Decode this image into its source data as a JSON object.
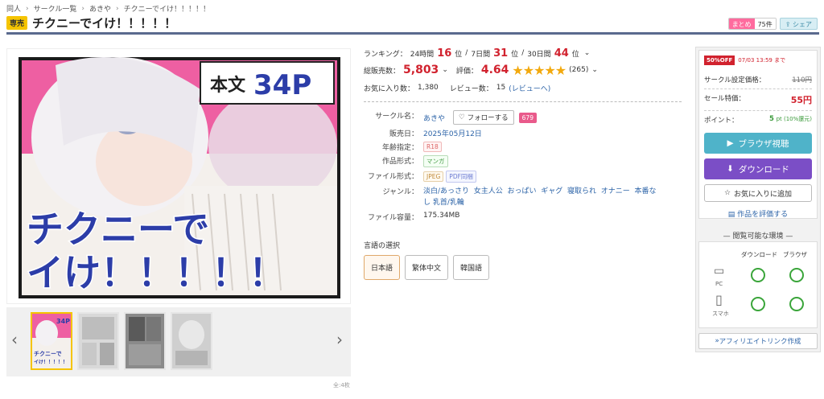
{
  "breadcrumb": [
    "同人",
    "サークル一覧",
    "あきや",
    "チクニーでイけ！！！！！"
  ],
  "title": {
    "badge": "専売",
    "text": "チクニーでイけ！！！！！"
  },
  "header_buttons": {
    "matome": "まとめ",
    "matome_count": "75件",
    "share": "シェア"
  },
  "cover": {
    "pages": "本文",
    "pages_num": "34P",
    "headline_1": "チクニーで",
    "headline_2": "イけ！！！！！"
  },
  "thumbs": {
    "mini_title": "チクニーで",
    "mini_title2": "イけ！！！！！",
    "mini_34p": "34P"
  },
  "gallery_count": "全:4枚",
  "ranking": {
    "label": "ランキング：",
    "p24": "24時間",
    "v24": "16",
    "unit": "位",
    "sep": "/",
    "p7": "7日間",
    "v7": "31",
    "p30": "30日間",
    "v30": "44"
  },
  "sales": {
    "label": "総販売数：",
    "value": "5,803",
    "rating_label": "評価：",
    "rating": "4.64",
    "stars": "★★★★★",
    "review_count": "(265)"
  },
  "favs": {
    "label": "お気に入り数：",
    "value": "1,380",
    "review_label": "レビュー数：",
    "review_value": "15",
    "review_link": "(レビューへ)"
  },
  "spec": {
    "circle_label": "サークル名：",
    "circle": "あきや",
    "follow": "フォローする",
    "follow_count": "679",
    "date_label": "販売日：",
    "date": "2025年05月12日",
    "age_label": "年齢指定：",
    "age": "R18",
    "format_label": "作品形式：",
    "format": "マンガ",
    "file_label": "ファイル形式：",
    "file1": "JPEG",
    "file2": "PDF同梱",
    "genre_label": "ジャンル：",
    "genres": [
      "淡白/あっさり",
      "女主人公",
      "おっぱい",
      "ギャグ",
      "寝取られ",
      "オナニー",
      "本番なし",
      "乳首/乳輪"
    ],
    "size_label": "ファイル容量：",
    "size": "175.34MB"
  },
  "language": {
    "label": "言語の選択",
    "options": [
      "日本語",
      "繁体中文",
      "韓国語"
    ]
  },
  "buy": {
    "off": "50%OFF",
    "deadline": "07/03 13:59 まで",
    "list_label": "サークル設定価格：",
    "list_price": "110円",
    "sale_label": "セール特価：",
    "sale_price": "55円",
    "point_label": "ポイント：",
    "point_value": "5",
    "point_note": "pt (10%還元)",
    "browser_btn": "ブラウザ視聴",
    "download_btn": "ダウンロード",
    "fav_btn": "お気に入りに追加",
    "rate_link": "作品を評価する"
  },
  "env": {
    "title": "閲覧可能な環境",
    "col1": "ダウンロード",
    "col2": "ブラウザ",
    "pc": "PC",
    "sp": "スマホ"
  },
  "affiliate": "アフィリエイトリンク作成",
  "colors": {
    "accent_red": "#d1222e",
    "teal": "#4fb3c9",
    "purple": "#7b4ec6",
    "star": "#f2a90e"
  }
}
